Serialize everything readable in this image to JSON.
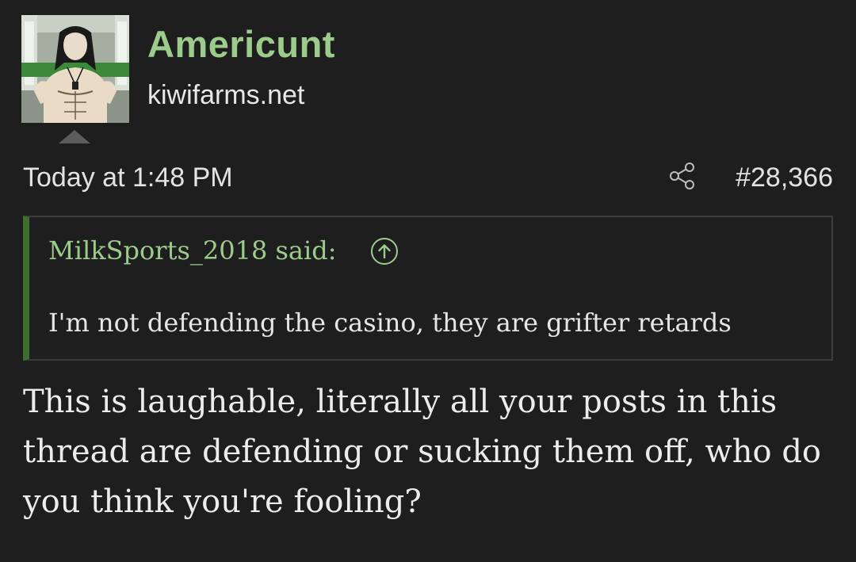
{
  "post": {
    "username": "Americunt",
    "user_title": "kiwifarms.net",
    "date": "Today at 1:48 PM",
    "post_number": "#28,366",
    "quote": {
      "attribution": "MilkSports_2018 said:",
      "text": "I'm not defending the casino, they are grifter retards"
    },
    "message": "This is laughable, literally all your posts in this thread are defending or sucking them off, who do you think you're fooling?"
  },
  "icons": {
    "share": "share-icon",
    "quote_jump": "arrow-up-circle-icon"
  },
  "colors": {
    "background": "#1e1e1e",
    "username": "#9ccc8c",
    "quote_accent": "#3e6e2e",
    "quote_border": "#3c3c3c"
  }
}
